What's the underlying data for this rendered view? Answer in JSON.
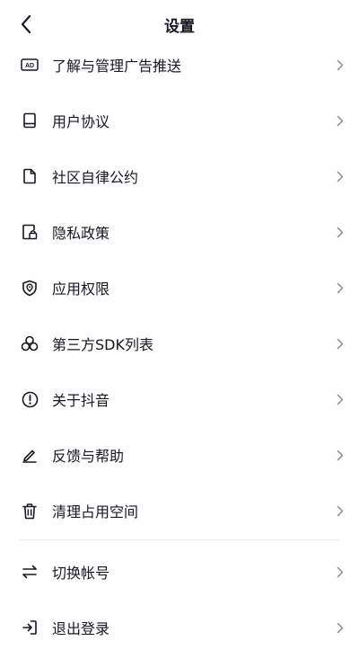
{
  "header": {
    "title": "设置",
    "back_icon": "chevron-left-icon"
  },
  "items": [
    {
      "label": "了解与管理广告推送",
      "icon": "ad-icon"
    },
    {
      "label": "用户协议",
      "icon": "book-icon"
    },
    {
      "label": "社区自律公约",
      "icon": "document-icon"
    },
    {
      "label": "隐私政策",
      "icon": "privacy-lock-document-icon"
    },
    {
      "label": "应用权限",
      "icon": "shield-location-icon"
    },
    {
      "label": "第三方SDK列表",
      "icon": "triangle-circles-icon"
    },
    {
      "label": "关于抖音",
      "icon": "info-circle-icon"
    },
    {
      "label": "反馈与帮助",
      "icon": "pen-edit-icon"
    },
    {
      "label": "清理占用空间",
      "icon": "trash-icon"
    },
    {
      "label": "切换帐号",
      "icon": "swap-arrows-icon"
    },
    {
      "label": "退出登录",
      "icon": "logout-icon"
    }
  ],
  "colors": {
    "text": "#161823",
    "icon": "#161823",
    "chevron": "#8a8b91",
    "divider": "#ececec",
    "background": "#ffffff"
  }
}
